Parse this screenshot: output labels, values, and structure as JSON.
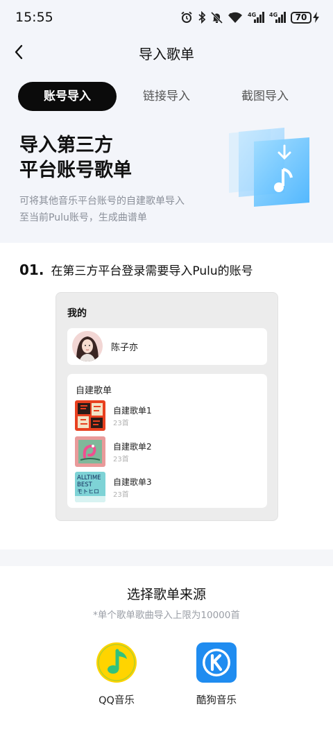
{
  "status_bar": {
    "time": "15:55",
    "battery": "70",
    "icons": [
      "alarm-icon",
      "bluetooth-icon",
      "mute-icon",
      "wifi-icon",
      "signal-4g-icon",
      "signal-4g-icon",
      "battery-icon",
      "charging-icon"
    ],
    "signal_label": "4G",
    "wifi_label": "6"
  },
  "nav": {
    "title": "导入歌单",
    "back_icon": "chevron-left-icon"
  },
  "tabs": [
    {
      "label": "账号导入",
      "active": true
    },
    {
      "label": "链接导入",
      "active": false
    },
    {
      "label": "截图导入",
      "active": false
    }
  ],
  "hero": {
    "title_line1": "导入第三方",
    "title_line2": "平台账号歌单",
    "desc_line1": "可将其他音乐平台账号的自建歌单导入",
    "desc_line2": "至当前Pulu账号，生成曲谱单"
  },
  "step": {
    "number": "01.",
    "text": "在第三方平台登录需要导入Pulu的账号"
  },
  "illustration": {
    "header": "我的",
    "profile_name": "陈子亦",
    "list_header": "自建歌单",
    "playlists": [
      {
        "name": "自建歌单1",
        "count": "23首"
      },
      {
        "name": "自建歌单2",
        "count": "23首"
      },
      {
        "name": "自建歌单3",
        "count": "23首"
      }
    ],
    "cover3_text1": "ALLTIME",
    "cover3_text2": "BEST",
    "cover3_text3": "モトヒロ"
  },
  "sheet": {
    "title": "选择歌单来源",
    "subtitle": "*单个歌单歌曲导入上限为10000首",
    "sources": [
      {
        "label": "QQ音乐",
        "icon": "qq-music-icon",
        "color": "#ffd400"
      },
      {
        "label": "酷狗音乐",
        "icon": "kugou-music-icon",
        "color": "#1f8cf0"
      }
    ]
  },
  "colors": {
    "accent": "#0b0b0b",
    "page_bg": "#f3f5fa",
    "muted_text": "#8a8f99"
  }
}
